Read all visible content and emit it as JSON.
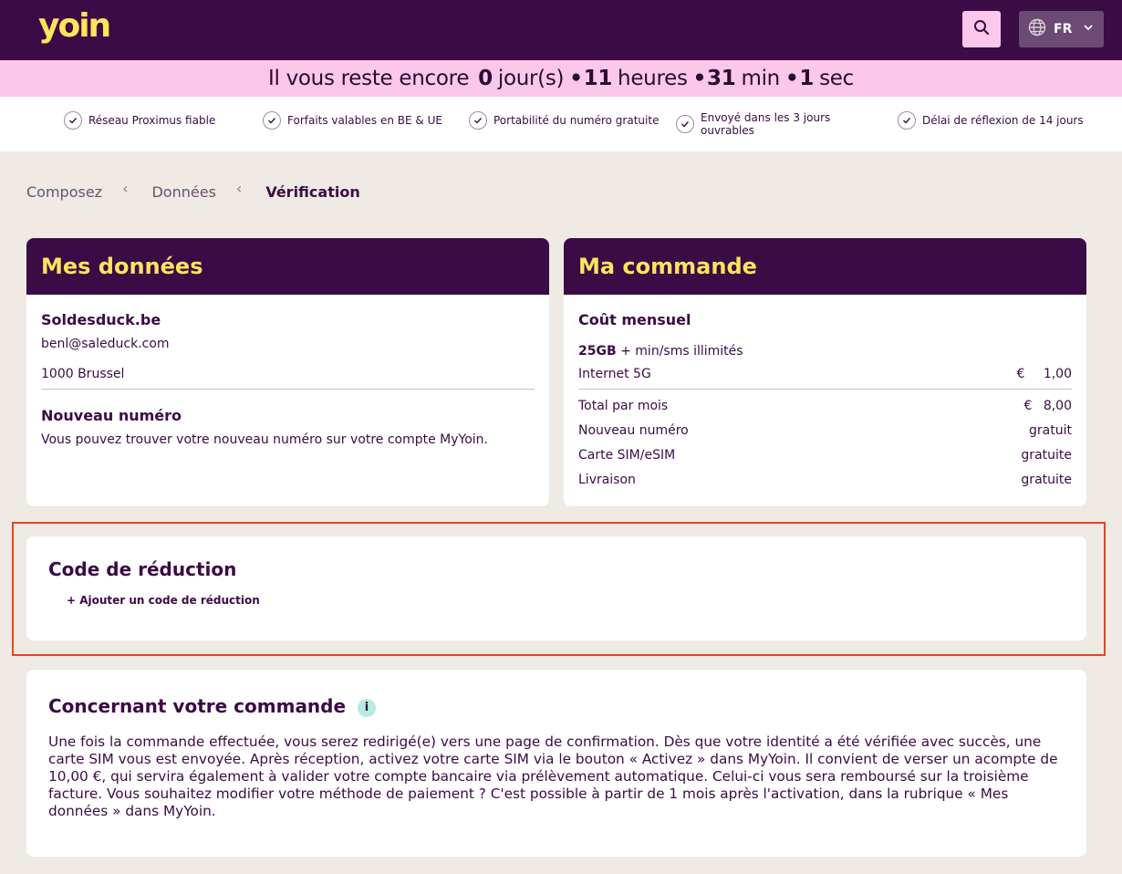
{
  "header": {
    "logo_text": "yoin",
    "lang": "FR",
    "brand_color": "#3b0b45",
    "accent_color": "#ffe45c",
    "icons": {
      "search": "search-icon",
      "globe": "globe-icon",
      "chevron": "chevron-down-icon"
    }
  },
  "countdown": {
    "prefix": "Il vous reste encore",
    "days": "0",
    "days_unit": "jour(s)",
    "hours": "11",
    "hours_unit": "heures",
    "minutes": "31",
    "minutes_unit": "min",
    "seconds": "1",
    "seconds_unit": "sec"
  },
  "usps": [
    "Réseau Proximus fiable",
    "Forfaits valables en BE & UE",
    "Portabilité du numéro gratuite",
    "Envoyé dans les 3 jours ouvrables",
    "Délai de réflexion de 14 jours"
  ],
  "breadcrumb": {
    "step1": "Composez",
    "step2": "Données",
    "step3": "Vérification"
  },
  "mes_donnees": {
    "title": "Mes données",
    "name": "Soldesduck.be",
    "email": "benl@saleduck.com",
    "city": "1000 Brussel",
    "new_number_title": "Nouveau numéro",
    "new_number_text": "Vous pouvez trouver votre nouveau numéro sur votre compte MyYoin."
  },
  "ma_commande": {
    "title": "Ma commande",
    "cost_title": "Coût mensuel",
    "plan_data": "25GB",
    "plan_rest": "+ min/sms illimités",
    "internet_label": "Internet 5G",
    "internet_currency": "€",
    "internet_price": "1,00",
    "total_label": "Total par mois",
    "total_currency": "€",
    "total_price": "8,00",
    "new_number_label": "Nouveau numéro",
    "new_number_value": "gratuit",
    "sim_label": "Carte SIM/eSIM",
    "sim_value": "gratuite",
    "delivery_label": "Livraison",
    "delivery_value": "gratuite"
  },
  "reduction": {
    "title": "Code de réduction",
    "add_link": "+ Ajouter un code de réduction"
  },
  "concernant": {
    "title": "Concernant votre commande",
    "info_icon": "i",
    "text": "Une fois la commande effectuée, vous serez redirigé(e) vers une page de confirmation. Dès que votre identité a été vérifiée avec succès, une carte SIM vous est envoyée. Après réception, activez votre carte SIM via le bouton « Activez » dans MyYoin. Il convient de verser un acompte de 10,00 €, qui servira également à valider votre compte bancaire via prélèvement automatique. Celui-ci vous sera remboursé sur la troisième facture. Vous souhaitez modifier votre méthode de paiement ? C'est possible à partir de 1 mois après l'activation, dans la rubrique « Mes données » dans MyYoin."
  }
}
